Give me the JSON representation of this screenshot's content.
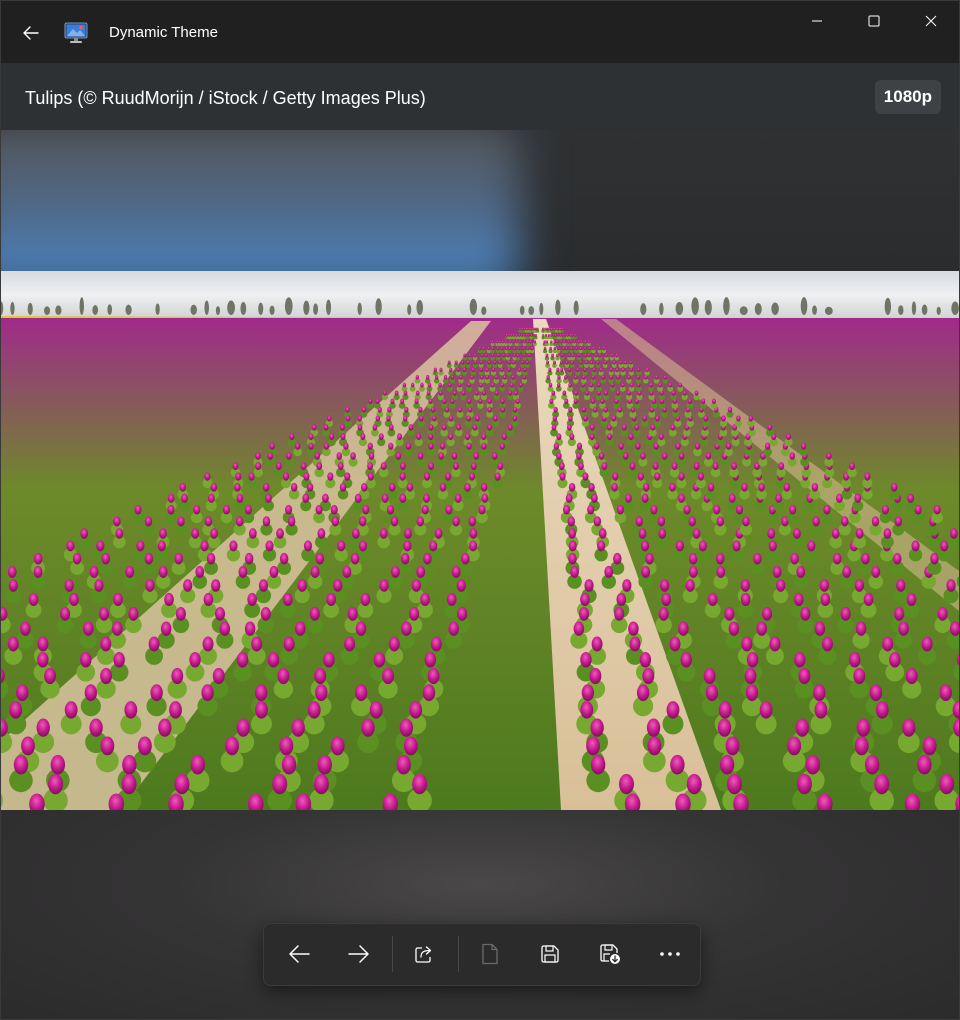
{
  "window": {
    "title": "Dynamic Theme"
  },
  "caption": {
    "text": "Tulips (© RuudMorijn / iStock / Getty Images Plus)",
    "resolution_badge": "1080p"
  },
  "icons": {
    "back": "back-arrow-icon",
    "app": "monitor-theme-icon",
    "minimize": "minimize-icon",
    "maximize": "maximize-icon",
    "close": "close-icon",
    "previous": "arrow-left-icon",
    "next": "arrow-right-icon",
    "share": "share-icon",
    "file": "file-icon",
    "save": "save-icon",
    "save_as": "save-download-icon",
    "more": "more-icon"
  },
  "colors": {
    "titlebar": "#202020",
    "accent_blue": "#4a8ad0",
    "tulip_magenta": "#c0208f"
  }
}
